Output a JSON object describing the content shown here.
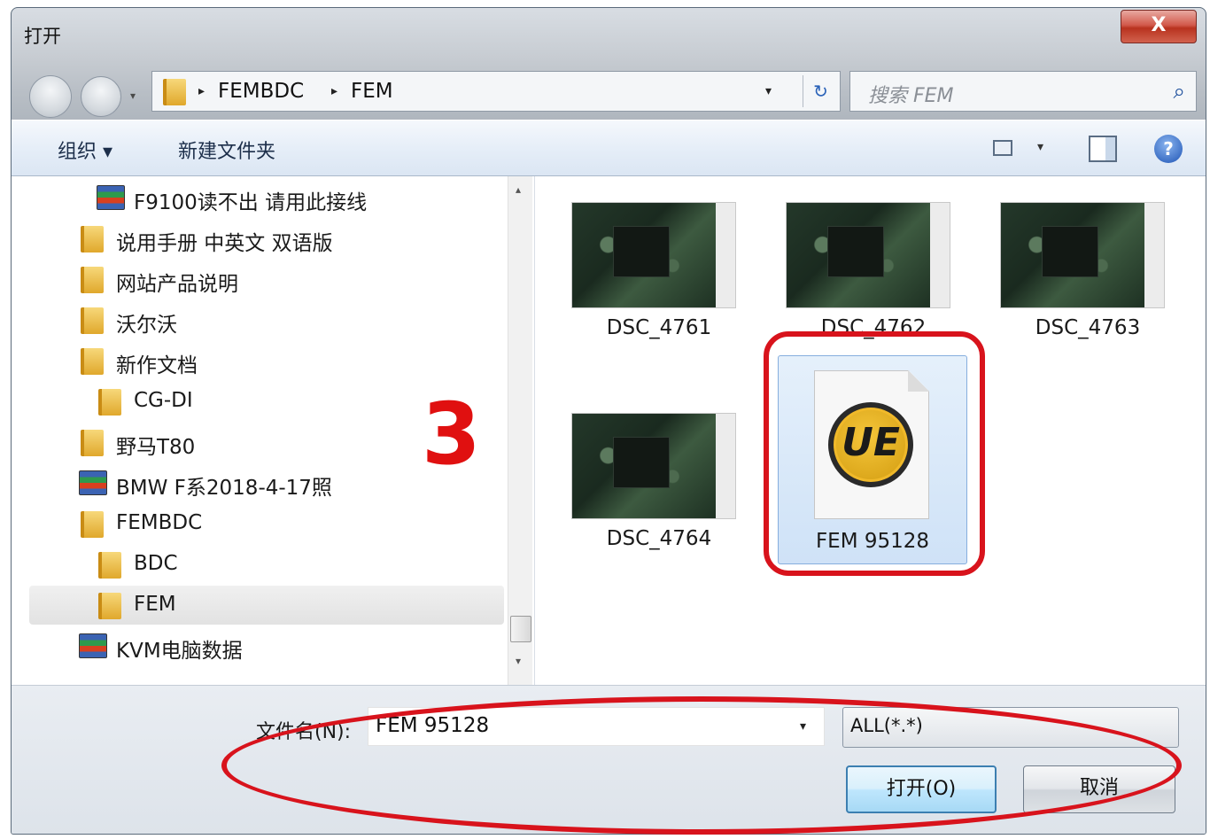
{
  "window": {
    "title": "打开",
    "close_glyph": "X"
  },
  "nav": {
    "address": {
      "crumbs": [
        "FEMBDC",
        "FEM"
      ],
      "separator": "▸",
      "dropdown_glyph": "▾",
      "refresh_glyph": "↻"
    },
    "search": {
      "placeholder": "搜索 FEM",
      "icon": "search-icon",
      "icon_glyph": "⌕"
    }
  },
  "toolbar": {
    "organize": "组织 ▾",
    "new_folder": "新建文件夹",
    "view_dd": "▾",
    "help_glyph": "?"
  },
  "tree": {
    "items": [
      {
        "label": "F9100读不出 请用此接线",
        "icon": "archive-icon"
      },
      {
        "label": "说用手册 中英文 双语版",
        "icon": "folder-icon"
      },
      {
        "label": "网站产品说明",
        "icon": "folder-icon"
      },
      {
        "label": "沃尔沃",
        "icon": "folder-icon"
      },
      {
        "label": "新作文档",
        "icon": "folder-icon"
      },
      {
        "label": "CG-DI",
        "icon": "folder-icon"
      },
      {
        "label": "野马T80",
        "icon": "folder-icon"
      },
      {
        "label": "BMW F系2018-4-17照",
        "icon": "archive-icon"
      },
      {
        "label": "FEMBDC",
        "icon": "folder-icon"
      },
      {
        "label": "BDC",
        "icon": "folder-icon"
      },
      {
        "label": "FEM",
        "icon": "folder-icon",
        "selected": true
      },
      {
        "label": "KVM电脑数据",
        "icon": "archive-icon"
      }
    ],
    "scroll_up": "▴",
    "scroll_down": "▾"
  },
  "files": [
    {
      "name": "DSC_4761",
      "type": "image"
    },
    {
      "name": "DSC_4762",
      "type": "image"
    },
    {
      "name": "DSC_4763",
      "type": "image"
    },
    {
      "name": "DSC_4764",
      "type": "image"
    },
    {
      "name": "FEM 95128",
      "type": "ue-document",
      "selected": true,
      "logo_text": "UE"
    }
  ],
  "footer": {
    "filename_label": "文件名(N):",
    "filename_value": "FEM 95128",
    "filename_dd": "▾",
    "filter_value": "ALL(*.*)",
    "open_button": "打开(O)",
    "cancel_button": "取消"
  },
  "annotation": {
    "step_number": "3",
    "color": "#d8131c"
  }
}
